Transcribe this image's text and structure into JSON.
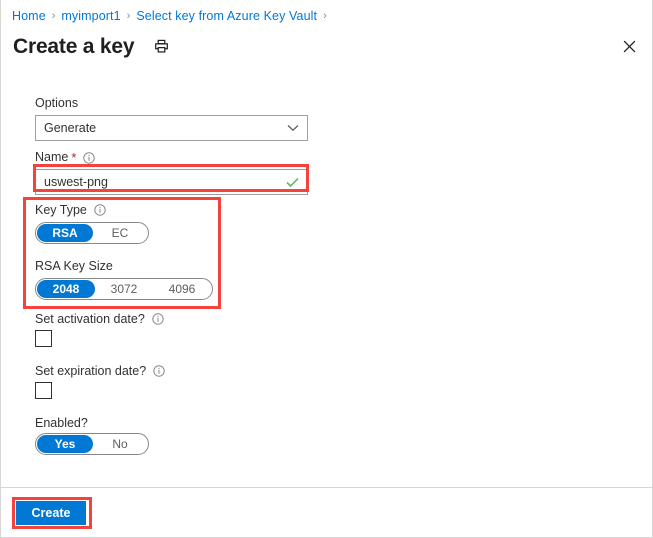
{
  "breadcrumb": {
    "items": [
      {
        "label": "Home"
      },
      {
        "label": "myimport1"
      },
      {
        "label": "Select key from Azure Key Vault"
      }
    ],
    "separator": "›"
  },
  "header": {
    "title": "Create a key",
    "print_icon": "printer-icon",
    "close_icon": "close-icon"
  },
  "form": {
    "options": {
      "label": "Options",
      "value": "Generate",
      "placeholder": "Generate",
      "chevron": "chevron-down-icon"
    },
    "name": {
      "label": "Name",
      "required_marker": "*",
      "info": "info-icon",
      "value": "uswest-png",
      "placeholder": "uswest-png",
      "validation_icon": "check-icon",
      "validation_color": "#5cb85c"
    },
    "key_type": {
      "label": "Key Type",
      "info": "info-icon",
      "options": [
        "RSA",
        "EC"
      ],
      "selected": "RSA"
    },
    "rsa_key_size": {
      "label": "RSA Key Size",
      "options": [
        "2048",
        "3072",
        "4096"
      ],
      "selected": "2048"
    },
    "set_activation_date": {
      "label": "Set activation date?",
      "info": "info-icon",
      "checked": false
    },
    "set_expiration_date": {
      "label": "Set expiration date?",
      "info": "info-icon",
      "checked": false
    },
    "enabled": {
      "label": "Enabled?",
      "options": [
        "Yes",
        "No"
      ],
      "selected": "Yes"
    }
  },
  "footer": {
    "create_label": "Create"
  },
  "colors": {
    "accent_blue": "#0078d4",
    "link_blue": "#0078d4",
    "highlight_red": "#f4433c",
    "required_red": "#a4262c",
    "success_green": "#5cb85c"
  }
}
